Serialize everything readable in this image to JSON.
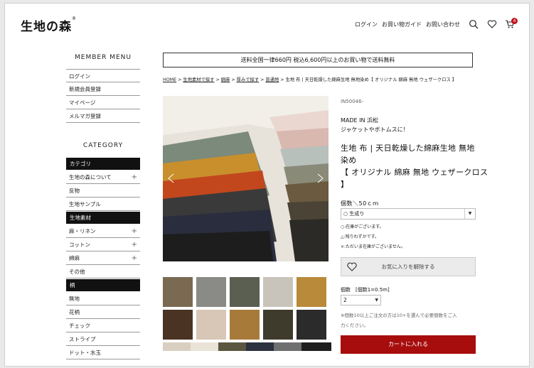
{
  "header": {
    "logo": "生地の森",
    "logo_mark": "®",
    "nav": {
      "login": "ログイン",
      "guide": "お買い物ガイド",
      "contact": "お問い合わせ"
    },
    "cart_count": "4",
    "icons": [
      "search-icon",
      "heart-icon",
      "cart-icon"
    ]
  },
  "sidebar": {
    "member_title": "MEMBER MENU",
    "member_items": [
      "ログイン",
      "新規会員登録",
      "マイページ",
      "メルマガ登録"
    ],
    "category_title": "CATEGORY",
    "sections": [
      {
        "heading": "カテゴリ",
        "items": [
          {
            "label": "生地の森について",
            "expand": "+"
          },
          {
            "label": "反物",
            "expand": ""
          },
          {
            "label": "生地サンプル",
            "expand": ""
          }
        ]
      },
      {
        "heading": "生地素材",
        "items": [
          {
            "label": "麻・リネン",
            "expand": "+"
          },
          {
            "label": "コットン",
            "expand": "+"
          },
          {
            "label": "綿麻",
            "expand": "+"
          },
          {
            "label": "その他",
            "expand": ""
          }
        ]
      },
      {
        "heading": "柄",
        "items": [
          {
            "label": "無地",
            "expand": ""
          },
          {
            "label": "花柄",
            "expand": ""
          },
          {
            "label": "チェック",
            "expand": ""
          },
          {
            "label": "ストライプ",
            "expand": ""
          },
          {
            "label": "ドット・水玉",
            "expand": ""
          }
        ]
      }
    ]
  },
  "banner": "送料全国一律660円 税込6,600円以上のお買い物で送料無料",
  "breadcrumb": {
    "links": [
      "HOME",
      "生地素材で探す",
      "綿麻",
      "厚みで探す",
      "普通地"
    ],
    "separator": " > ",
    "current": "生地 布 | 天日乾燥した綿麻生地 無地染め【 オリジナル 綿麻 無地 ウェザークロス 】"
  },
  "product": {
    "sku": "IN50046-",
    "origin": "MADE IN 浜松",
    "catch": "ジャケットやボトムスに！",
    "title_lines": [
      "生地 布 | 天日乾燥した綿麻生地 無地",
      "染め",
      "【 オリジナル 綿麻 無地 ウェザークロス",
      "】"
    ],
    "qty_unit_label": "個数＼50ｃｍ",
    "variant_selected": "○ 生成り",
    "legend": [
      "○:在庫がございます。",
      "△:残りわずかです。",
      "×:ただいま在庫がございません。"
    ],
    "favorite_label": "お気に入りを解除する",
    "unit_label": "個数　[個数1=0.5m]",
    "qty_selected": "2",
    "qty_note_lines": [
      "※個数10以上ご注文の方は10+を選んで必要個数をご入",
      "力ください。"
    ],
    "cart_label": "カートに入れる"
  },
  "colors": {
    "accent_red": "#a70d0d",
    "badge_red": "#c0151b",
    "category_heading_bg": "#111111",
    "favorite_bg": "#ebebeb"
  },
  "gallery": {
    "thumbs_row1": [
      "#7a6a52",
      "#8a8a86",
      "#5b5f52",
      "#c9c4bb",
      "#b98a3a"
    ],
    "thumbs_row2": [
      "#4a3322",
      "#d8c7b6",
      "#a87a3a",
      "#3f3b2c",
      "#2b2b2b"
    ],
    "thumbs_row3": [
      "#d9cfc0",
      "#eae3d8",
      "#5a5640",
      "#2c3140",
      "#6f6f6f",
      "#1e1e1e"
    ]
  }
}
